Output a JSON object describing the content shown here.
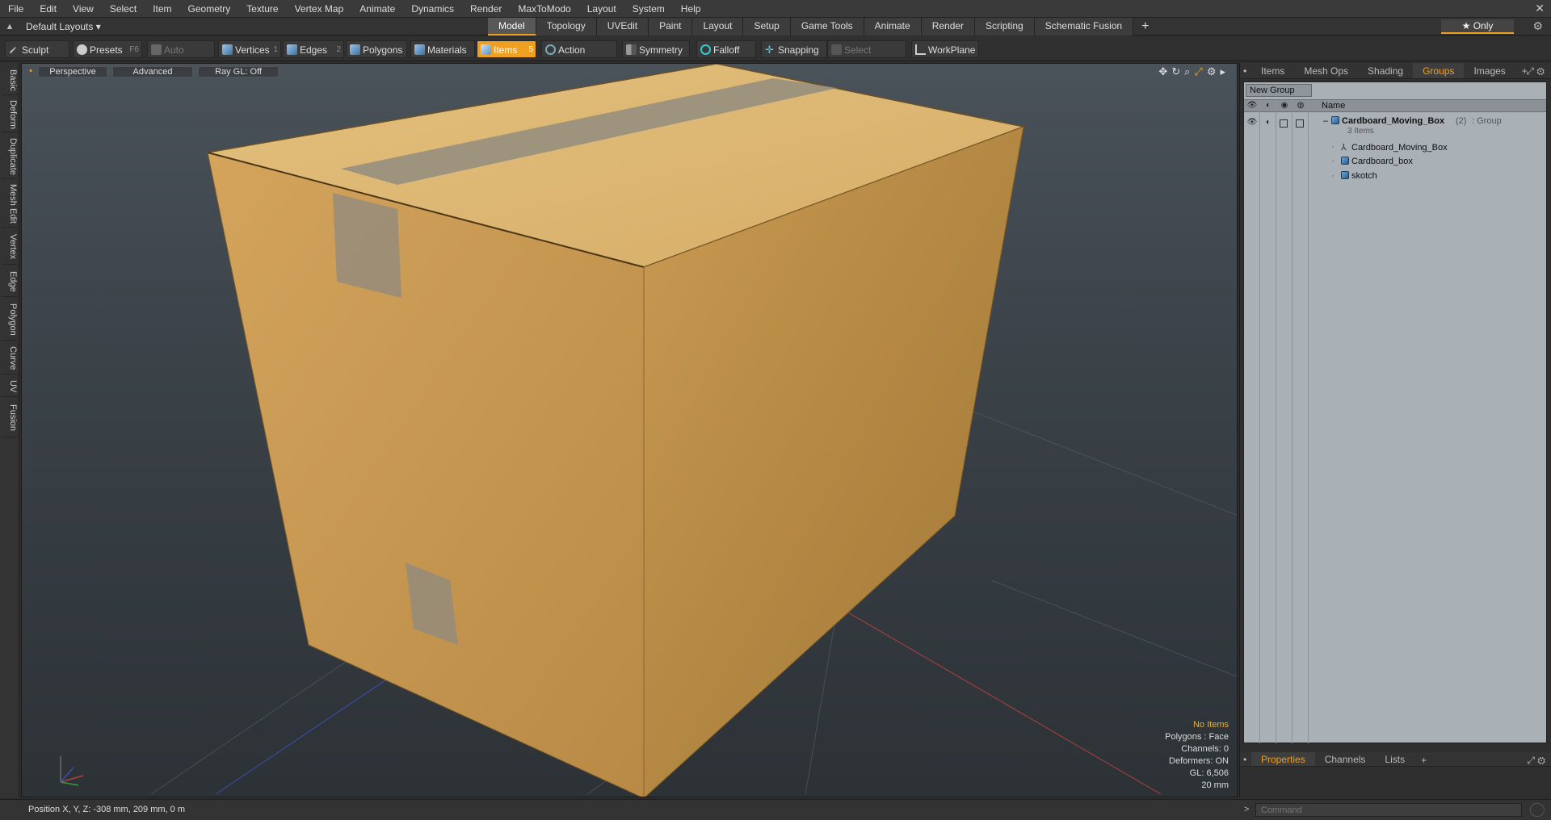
{
  "menu": [
    "File",
    "Edit",
    "View",
    "Select",
    "Item",
    "Geometry",
    "Texture",
    "Vertex Map",
    "Animate",
    "Dynamics",
    "Render",
    "MaxToModo",
    "Layout",
    "System",
    "Help"
  ],
  "layout": {
    "dropdown": "Default Layouts ▾",
    "tabs": [
      "Model",
      "Topology",
      "UVEdit",
      "Paint",
      "Layout",
      "Setup",
      "Game Tools",
      "Animate",
      "Render",
      "Scripting",
      "Schematic Fusion"
    ],
    "active_tab": "Model",
    "only_label": "★  Only"
  },
  "toolbar": {
    "sculpt": "Sculpt",
    "presets": "Presets",
    "presets_key": "F6",
    "auto_select": "Auto Select",
    "vertices": "Vertices",
    "vertices_key": "1",
    "edges": "Edges",
    "edges_key": "2",
    "polygons": "Polygons",
    "materials": "Materials",
    "items": "Items",
    "items_key": "5",
    "action_center": "Action Center",
    "symmetry": "Symmetry",
    "falloff": "Falloff",
    "snapping": "Snapping",
    "select_through": "Select Through",
    "workplane": "WorkPlane"
  },
  "left_tabs": [
    "Basic",
    "Deform",
    "Duplicate",
    "Mesh Edit",
    "Vertex",
    "Edge",
    "Polygon",
    "Curve",
    "UV",
    "Fusion"
  ],
  "viewport": {
    "view": "Perspective",
    "shading": "Advanced",
    "raygl": "Ray GL: Off",
    "hud": {
      "selection": "No Items",
      "polygons": "Polygons : Face",
      "channels": "Channels: 0",
      "deformers": "Deformers: ON",
      "gl": "GL: 6,506",
      "scale": "20 mm"
    }
  },
  "right_tabs": [
    "Items",
    "Mesh Ops",
    "Shading",
    "Groups",
    "Images"
  ],
  "right_active": "Groups",
  "groups": {
    "new_group": "New Group",
    "col_name": "Name",
    "group_name": "Cardboard_Moving_Box",
    "group_count": "(2)",
    "group_type": ": Group",
    "group_sub": "3 Items",
    "children": [
      "Cardboard_Moving_Box",
      "Cardboard_box",
      "skotch"
    ]
  },
  "bottom_tabs": [
    "Properties",
    "Channels",
    "Lists"
  ],
  "bottom_active": "Properties",
  "status": {
    "position": "Position X, Y, Z:  -308 mm, 209 mm, 0 m"
  },
  "command": {
    "placeholder": "Command"
  },
  "colors": {
    "accent": "#f0a020",
    "cardboard": "#d2a55e",
    "tape": "#8d8a80"
  }
}
